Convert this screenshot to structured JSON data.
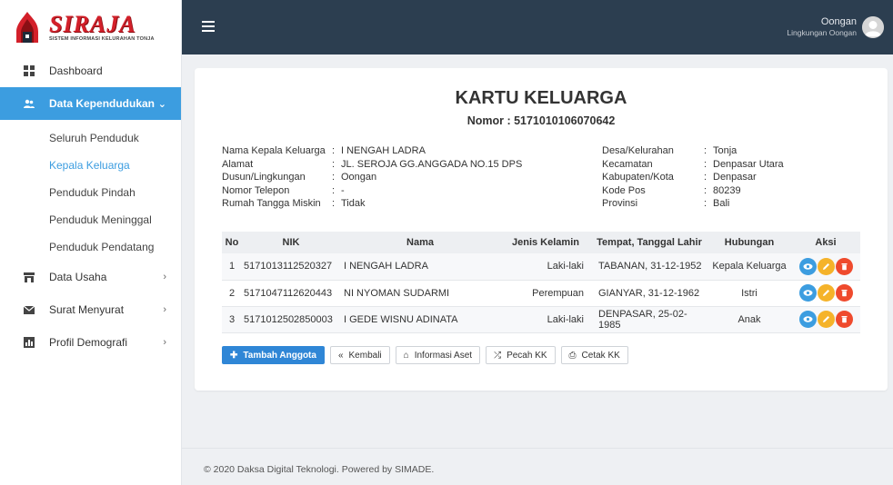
{
  "brand": {
    "logo_text": "SIRAJA",
    "subtitle": "SISTEM INFORMASI KELURAHAN TONJA"
  },
  "sidebar": {
    "items": [
      {
        "label": "Dashboard",
        "icon": "dashboard-icon"
      },
      {
        "label": "Data Kependudukan",
        "icon": "users-icon",
        "active": true
      },
      {
        "label": "Data Usaha",
        "icon": "store-icon"
      },
      {
        "label": "Surat Menyurat",
        "icon": "mail-icon"
      },
      {
        "label": "Profil Demografi",
        "icon": "chart-icon"
      }
    ],
    "subitems": [
      {
        "label": "Seluruh Penduduk"
      },
      {
        "label": "Kepala Keluarga",
        "active": true
      },
      {
        "label": "Penduduk Pindah"
      },
      {
        "label": "Penduduk Meninggal"
      },
      {
        "label": "Penduduk Pendatang"
      }
    ]
  },
  "topbar": {
    "user_name": "Oongan",
    "user_role": "Lingkungan Oongan"
  },
  "kk": {
    "title": "KARTU KELUARGA",
    "nomor": "Nomor : 5171010106070642",
    "left": [
      {
        "label": "Nama Kepala Keluarga",
        "value": "I NENGAH LADRA"
      },
      {
        "label": "Alamat",
        "value": "JL. SEROJA GG.ANGGADA NO.15 DPS"
      },
      {
        "label": "Dusun/Lingkungan",
        "value": "Oongan"
      },
      {
        "label": "Nomor Telepon",
        "value": "-"
      },
      {
        "label": "Rumah Tangga Miskin",
        "value": "Tidak"
      }
    ],
    "right": [
      {
        "label": "Desa/Kelurahan",
        "value": "Tonja"
      },
      {
        "label": "Kecamatan",
        "value": "Denpasar Utara"
      },
      {
        "label": "Kabupaten/Kota",
        "value": "Denpasar"
      },
      {
        "label": "Kode Pos",
        "value": "80239"
      },
      {
        "label": "Provinsi",
        "value": "Bali"
      }
    ],
    "sep": ":"
  },
  "table": {
    "headers": [
      "No",
      "NIK",
      "Nama",
      "Jenis Kelamin",
      "Tempat, Tanggal Lahir",
      "Hubungan",
      "Aksi"
    ],
    "rows": [
      {
        "no": "1",
        "nik": "5171013112520327",
        "nama": "I NENGAH LADRA",
        "jk": "Laki-laki",
        "ttl": "TABANAN, 31-12-1952",
        "hub": "Kepala Keluarga"
      },
      {
        "no": "2",
        "nik": "5171047112620443",
        "nama": "NI NYOMAN SUDARMI",
        "jk": "Perempuan",
        "ttl": "GIANYAR, 31-12-1962",
        "hub": "Istri"
      },
      {
        "no": "3",
        "nik": "5171012502850003",
        "nama": "I GEDE WISNU ADINATA",
        "jk": "Laki-laki",
        "ttl": "DENPASAR, 25-02-1985",
        "hub": "Anak"
      }
    ]
  },
  "buttons": {
    "tambah": "Tambah Anggota",
    "kembali": "Kembali",
    "aset": "Informasi Aset",
    "pecah": "Pecah KK",
    "cetak": "Cetak KK"
  },
  "footer": {
    "text": "© 2020 Daksa Digital Teknologi. Powered by SIMADE."
  },
  "colors": {
    "topbar": "#2c3e50",
    "accent": "#3c9de0",
    "view": "#3c9de0",
    "edit": "#f5b32a",
    "delete": "#ef4a2d"
  }
}
